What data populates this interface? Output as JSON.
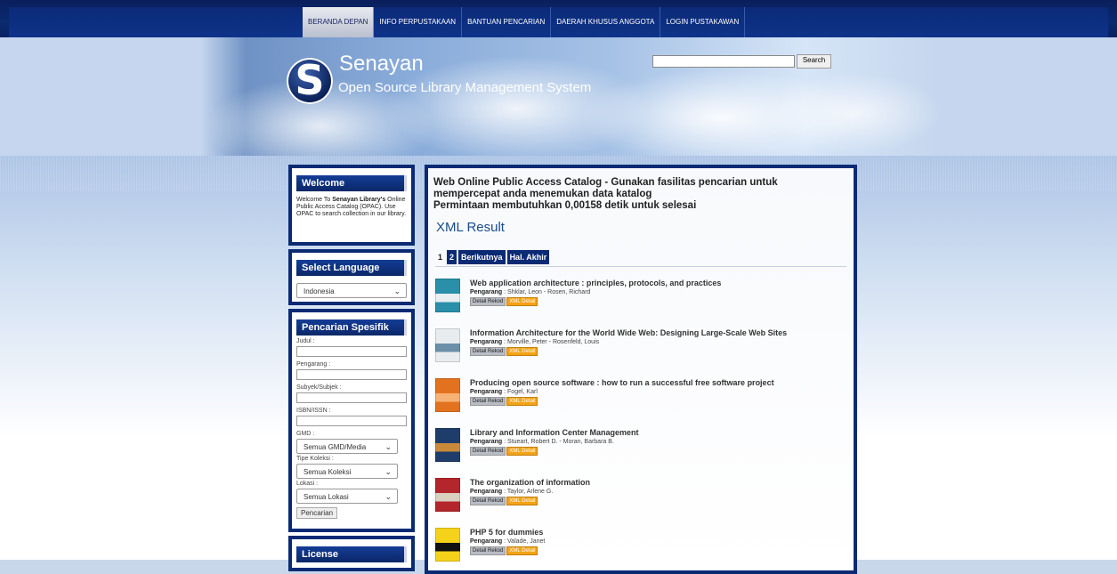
{
  "nav": {
    "items": [
      {
        "label": "BERANDA DEPAN",
        "active": true
      },
      {
        "label": "INFO PERPUSTAKAAN",
        "active": false
      },
      {
        "label": "BANTUAN PENCARIAN",
        "active": false
      },
      {
        "label": "DAERAH KHUSUS ANGGOTA",
        "active": false
      },
      {
        "label": "LOGIN PUSTAKAWAN",
        "active": false
      }
    ]
  },
  "header": {
    "site_name": "Senayan",
    "tagline": "Open Source Library Management System",
    "search_value": "",
    "search_button": "Search"
  },
  "sidebar": {
    "welcome": {
      "title": "Welcome",
      "text_pre": "Welcome To ",
      "text_bold": "Senayan Library's",
      "text_post": " Online Public Access Catalog (OPAC). Use OPAC to search collection in our library."
    },
    "language": {
      "title": "Select Language",
      "selected": "Indonesia"
    },
    "specific_search": {
      "title": "Pencarian Spesifik",
      "judul_label": "Judul :",
      "pengarang_label": "Pengarang :",
      "subyek_label": "Subyek/Subjek :",
      "isbn_label": "ISBN/ISSN :",
      "gmd_label": "GMD :",
      "gmd_selected": "Semua GMD/Media",
      "tipe_label": "Tipe Koleksi :",
      "tipe_selected": "Semua Koleksi",
      "lokasi_label": "Lokasi :",
      "lokasi_selected": "Semua Lokasi",
      "button": "Pencarian"
    },
    "license": {
      "title": "License"
    }
  },
  "main": {
    "title": "Web Online Public Access Catalog - Gunakan fasilitas pencarian untuk mempercepat anda menemukan data katalog",
    "timing": "Permintaan membutuhkan 0,00158 detik untuk selesai",
    "xml_result": "XML Result",
    "pager": {
      "current": "1",
      "page2": "2",
      "next": "Berikutnya",
      "last": "Hal. Akhir"
    },
    "author_label": "Pengarang",
    "detail_label": "Detail Rekod",
    "xml_label": "XML Detail",
    "results": [
      {
        "title": "Web application architecture : principles, protocols, and practices",
        "authors": "Shklar, Leon - Rosen, Richard",
        "cover_color": "#2a8fa8",
        "cover_accent": "#e8eef2"
      },
      {
        "title": "Information Architecture for the World Wide Web: Designing Large-Scale Web Sites",
        "authors": "Morville, Peter - Rosenfeld, Louis",
        "cover_color": "#e9ecef",
        "cover_accent": "#6b8fa8"
      },
      {
        "title": "Producing open source software : how to run a successful free software project",
        "authors": "Fogel, Karl",
        "cover_color": "#e3721f",
        "cover_accent": "#f6b274"
      },
      {
        "title": "Library and Information Center Management",
        "authors": "Stueart, Robert D. - Moran, Barbara B.",
        "cover_color": "#1f3d6b",
        "cover_accent": "#c98a3a"
      },
      {
        "title": "The organization of information",
        "authors": "Taylor, Arlene G.",
        "cover_color": "#b3262b",
        "cover_accent": "#d9d0c0"
      },
      {
        "title": "PHP 5 for dummies",
        "authors": "Valade, Janet",
        "cover_color": "#f5d21a",
        "cover_accent": "#111111"
      }
    ]
  }
}
